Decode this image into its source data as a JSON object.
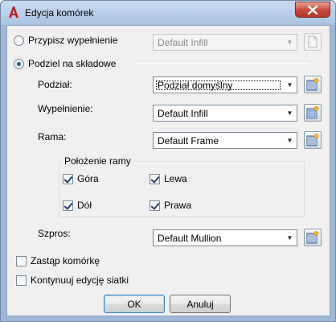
{
  "window": {
    "title": "Edycja komórek",
    "accent": "#c9473a"
  },
  "assign_fill": {
    "label": "Przypisz wypełnienie",
    "selected": false,
    "combo_value": "Default Infill",
    "enabled": false
  },
  "divide": {
    "label": "Podziel na składowe",
    "selected": true
  },
  "division": {
    "label": "Podział:",
    "combo_value": "Podział domyślny"
  },
  "infill": {
    "label": "Wypełnienie:",
    "combo_value": "Default Infill"
  },
  "frame": {
    "label": "Rama:",
    "combo_value": "Default Frame"
  },
  "frame_position": {
    "title": "Położenie ramy",
    "top": {
      "label": "Góra",
      "checked": true
    },
    "left": {
      "label": "Lewa",
      "checked": true
    },
    "bottom": {
      "label": "Dół",
      "checked": true
    },
    "right": {
      "label": "Prawa",
      "checked": true
    }
  },
  "mullion": {
    "label": "Szpros:",
    "combo_value": "Default Mullion"
  },
  "replace_cell": {
    "label": "Zastąp komórkę",
    "checked": false
  },
  "continue_edit": {
    "label": "Kontynuuj edycję siatki",
    "checked": false
  },
  "buttons": {
    "ok": "OK",
    "cancel": "Anuluj"
  },
  "icons": {
    "app": "autocad-a-icon",
    "close": "close-icon",
    "combo": "chevron-down-icon",
    "style": "style-manager-icon",
    "new_style": "new-style-icon"
  }
}
